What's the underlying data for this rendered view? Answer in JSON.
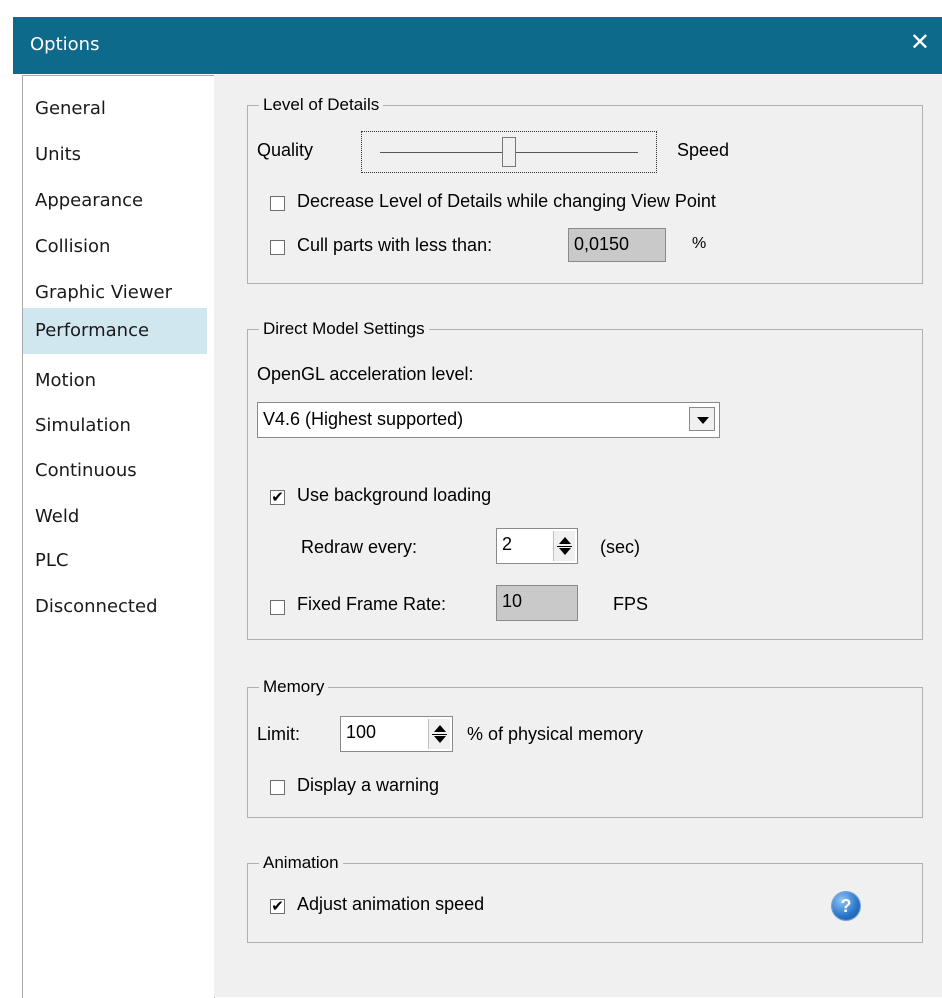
{
  "window": {
    "title": "Options",
    "close_glyph": "✕"
  },
  "nav": {
    "items": [
      {
        "label": "General"
      },
      {
        "label": "Units"
      },
      {
        "label": "Appearance"
      },
      {
        "label": "Collision"
      },
      {
        "label": "Graphic Viewer"
      },
      {
        "label": "Performance",
        "selected": true
      },
      {
        "label": "Motion"
      },
      {
        "label": "Simulation"
      },
      {
        "label": "Continuous"
      },
      {
        "label": "Weld"
      },
      {
        "label": "PLC"
      },
      {
        "label": "Disconnected"
      }
    ]
  },
  "lod": {
    "legend": "Level of Details",
    "quality_label": "Quality",
    "speed_label": "Speed",
    "decrease_lod": {
      "label": "Decrease Level of Details while changing View Point",
      "checked": false
    },
    "cull": {
      "label": "Cull parts with less than:",
      "checked": false,
      "value": "0,0150",
      "unit": "%"
    }
  },
  "direct_model": {
    "legend": "Direct Model Settings",
    "opengl_label": "OpenGL acceleration level:",
    "opengl_value": "V4.6 (Highest supported)",
    "background_loading": {
      "label": "Use background loading",
      "checked": true,
      "check_glyph": "✔"
    },
    "redraw_label": "Redraw every:",
    "redraw_value": "2",
    "redraw_unit": "(sec)",
    "fixed_frame": {
      "label": "Fixed Frame Rate:",
      "checked": false,
      "value": "10",
      "unit": "FPS"
    }
  },
  "memory": {
    "legend": "Memory",
    "limit_label": "Limit:",
    "limit_value": "100",
    "limit_unit": "% of physical memory",
    "warning": {
      "label": "Display a warning",
      "checked": false
    }
  },
  "animation": {
    "legend": "Animation",
    "adjust": {
      "label": "Adjust animation speed",
      "checked": true,
      "check_glyph": "✔"
    },
    "help_glyph": "?"
  }
}
